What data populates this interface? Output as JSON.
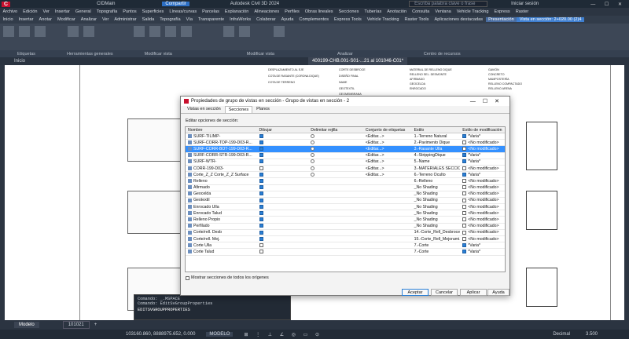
{
  "app": {
    "title": "Autodesk Civil 3D 2024",
    "file": "CIDMain",
    "share": "Compartir",
    "search_placeholder": "Escriba palabra clave o frase",
    "user": "Iniciar sesión"
  },
  "menu": [
    "Archivo",
    "Edición",
    "Ver",
    "Insertar",
    "General",
    "Topografía",
    "Puntos",
    "Superficies",
    "Líneas/curvas",
    "Parcelas",
    "Explanación",
    "Alineaciones",
    "Perfiles",
    "Obras lineales",
    "Secciones",
    "Tuberías",
    "Anotación",
    "Consulta",
    "Ventana",
    "Vehicle Tracking",
    "Express",
    "Raster"
  ],
  "tabs": [
    "Inicio",
    "Insertar",
    "Anotar",
    "Modificar",
    "Analizar",
    "Ver",
    "Administrar",
    "Salida",
    "Topografía",
    "Vía",
    "Transparente",
    "InfraWorks",
    "Colaborar",
    "Ayuda",
    "Complementos",
    "Express Tools",
    "Vehicle Tracking",
    "Raster Tools",
    "Aplicaciones destacadas",
    "Presentación",
    "Vista en sección: 2+020.00 (2)4"
  ],
  "ribbon_groups": [
    "Etiquetas",
    "Herramientas generales",
    "Modificar vista",
    "Modificar vista",
    "Analizar",
    "Centro de recursos"
  ],
  "doc_tabs": {
    "start": "Inicio",
    "file": "400199-CHB.001-S01-...21 al 101046-C01*"
  },
  "dialog": {
    "title": "Propiedades de grupo de vistas en sección - Grupo de vistas en sección - 2",
    "tabs": [
      "Vistas en sección",
      "Secciones",
      "Planos"
    ],
    "section_label": "Editar opciones de sección:",
    "headers": [
      "Nombre",
      "Dibujar",
      "Delimitar rejilla",
      "Conjunto de etiquetas",
      "Estilo",
      "Estilo de modificación"
    ],
    "rows": [
      {
        "name": "SURF-TILIMP-",
        "draw": true,
        "clip": false,
        "labels": "<Editar...>",
        "style": "1.-Terreno Natural",
        "override": true,
        "mod": "*Varia*",
        "selected": false
      },
      {
        "name": "SURF-CORR-TOP-199-D03-R...",
        "draw": true,
        "clip": false,
        "labels": "<Editar...>",
        "style": "2.-Pavimento Dique",
        "override": false,
        "mod": "<No modificado>",
        "selected": false
      },
      {
        "name": "SURF-CORR-BOT-199-D03-R...",
        "draw": true,
        "clip": false,
        "labels": "<Editar...>",
        "style": "3.-Rasante Ulla",
        "override": false,
        "mod": "<No modificado>",
        "selected": true
      },
      {
        "name": "SURF-CORR-STR-199-D03-R...",
        "draw": true,
        "clip": false,
        "labels": "<Editar...>",
        "style": "4.-StrippingDique",
        "override": true,
        "mod": "*Varia*",
        "selected": false
      },
      {
        "name": "SURF-WTR-",
        "draw": true,
        "clip": false,
        "labels": "<Editar...>",
        "style": "5.-Name",
        "override": true,
        "mod": "*Varia*",
        "selected": false
      },
      {
        "name": "CORR-199-D03-",
        "draw": false,
        "clip": false,
        "labels": "<Editar...>",
        "style": "3.-MATERIALES SECCIÓN",
        "override": false,
        "mod": "<No modificado>",
        "selected": false
      },
      {
        "name": "Corte_Z_Z Corte_Z_Z Surface",
        "draw": true,
        "clip": false,
        "labels": "<Editar...>",
        "style": "6.-Terreno Oculto",
        "override": true,
        "mod": "*Varia*",
        "selected": false
      },
      {
        "name": "Relleno",
        "draw": true,
        "clip": null,
        "labels": "",
        "style": "6.-Relleno",
        "override": false,
        "mod": "<No modificado>",
        "selected": false
      },
      {
        "name": "Afirmado",
        "draw": true,
        "clip": null,
        "labels": "",
        "style": "_No Shading",
        "override": false,
        "mod": "<No modificado>",
        "selected": false
      },
      {
        "name": "Geocelda",
        "draw": true,
        "clip": null,
        "labels": "",
        "style": "_No Shading",
        "override": false,
        "mod": "<No modificado>",
        "selected": false
      },
      {
        "name": "Geotextil",
        "draw": true,
        "clip": null,
        "labels": "",
        "style": "_No Shading",
        "override": false,
        "mod": "<No modificado>",
        "selected": false
      },
      {
        "name": "Enrocado Ulla",
        "draw": true,
        "clip": null,
        "labels": "",
        "style": "_No Shading",
        "override": false,
        "mod": "<No modificado>",
        "selected": false
      },
      {
        "name": "Enrocado Talud",
        "draw": true,
        "clip": null,
        "labels": "",
        "style": "_No Shading",
        "override": false,
        "mod": "<No modificado>",
        "selected": false
      },
      {
        "name": "Relleno Propio",
        "draw": true,
        "clip": null,
        "labels": "",
        "style": "_No Shading",
        "override": false,
        "mod": "<No modificado>",
        "selected": false
      },
      {
        "name": "Perfilado",
        "draw": true,
        "clip": null,
        "labels": "",
        "style": "_No Shading",
        "override": false,
        "mod": "<No modificado>",
        "selected": false
      },
      {
        "name": "Corte/rell. Desb",
        "draw": true,
        "clip": null,
        "labels": "",
        "style": "14.-Corte_Rell_Desbroce",
        "override": false,
        "mod": "<No modificado>",
        "selected": false
      },
      {
        "name": "Corte/rell. Mej.",
        "draw": true,
        "clip": null,
        "labels": "",
        "style": "15.-Corte_Rell_Mejorami...",
        "override": false,
        "mod": "<No modificado>",
        "selected": false
      },
      {
        "name": "Corte Ulla",
        "draw": false,
        "clip": null,
        "labels": "",
        "style": "7.-Corte",
        "override": true,
        "mod": "*Varia*",
        "selected": false
      },
      {
        "name": "Corte Talud",
        "draw": false,
        "clip": null,
        "labels": "",
        "style": "7.-Corte",
        "override": true,
        "mod": "*Varia*",
        "selected": false
      }
    ],
    "show_all": "Mostrar secciones de todos los orígenes",
    "buttons": [
      "Aceptar",
      "Cancelar",
      "Aplicar",
      "Ayuda"
    ]
  },
  "drawing_header": [
    "DESPLAZAMIENTO AL EJE",
    "COTA DE RASANTE (CORONA DIQUE)",
    "COTA DE TERRENO",
    "CORTE DESBROCE",
    "DISEÑO FINAL",
    "NAME",
    "GEOTEXTIL",
    "GEOMEMBRANA",
    "MATERIAL DE RELLENO DIQUE",
    "RELLENO SEL. DESMONTE",
    "AFIRMADO",
    "GEOCELDA",
    "ENROCADO",
    "GAVIÓN",
    "CONCRETO",
    "MAMPOSTERÍA",
    "RELLENO COMPACTADO",
    "RELLENO ARENA"
  ],
  "command": {
    "lines": [
      "Comando:  _.MSPACE",
      "Comando:  EditSvGroupProperties"
    ],
    "prompt": "EDITSVGROUPPROPERTIES"
  },
  "layout_tabs": [
    "Modelo",
    "101021"
  ],
  "coords": "103160.860, 8888975.652, 0.000",
  "mode": "MODELO",
  "units": "Decimal",
  "scale": "3.500"
}
